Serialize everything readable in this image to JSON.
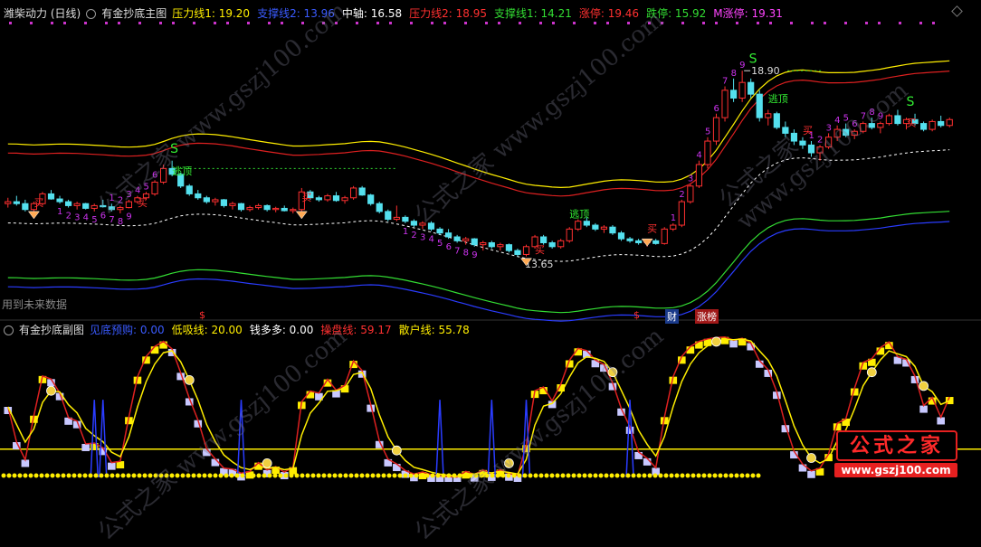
{
  "main_header": {
    "stock": "潍柴动力 (日线)",
    "indicator": "有金抄底主图",
    "items": [
      {
        "label": "压力线1: ",
        "value": "19.20",
        "color": "#ffee00"
      },
      {
        "label": "支撑线2: ",
        "value": "13.96",
        "color": "#3a5bff"
      },
      {
        "label": "中轴: ",
        "value": "16.58",
        "color": "#ffffff"
      },
      {
        "label": "压力线2: ",
        "value": "18.95",
        "color": "#ff3030"
      },
      {
        "label": "支撑线1: ",
        "value": "14.21",
        "color": "#33dd33"
      },
      {
        "label": "涨停: ",
        "value": "19.46",
        "color": "#ff3030"
      },
      {
        "label": "跌停: ",
        "value": "15.92",
        "color": "#33dd33"
      },
      {
        "label": "M涨停: ",
        "value": "19.31",
        "color": "#ff44ff"
      }
    ]
  },
  "sub_header": {
    "indicator": "有金抄底副图",
    "items": [
      {
        "label": "见底预购: ",
        "value": "0.00",
        "color": "#3a5bff"
      },
      {
        "label": "低吸线: ",
        "value": "20.00",
        "color": "#ffee00"
      },
      {
        "label": "钱多多: ",
        "value": "0.00",
        "color": "#ffffff"
      },
      {
        "label": "操盘线: ",
        "value": "59.17",
        "color": "#ff3030"
      },
      {
        "label": "散户线: ",
        "value": "55.78",
        "color": "#ffee00"
      }
    ]
  },
  "future_note": "用到未来数据",
  "bottom_badges": [
    {
      "text": "$",
      "color": "#ff3030"
    },
    {
      "text": "$",
      "color": "#ff3030"
    },
    {
      "text": "财",
      "color": "#ffffff"
    },
    {
      "text": "涨榜",
      "color": "#ffffff"
    }
  ],
  "watermark": "公式之家 www.gszj100.com",
  "logo": {
    "title": "公式之家",
    "url": "www.gszj100.com"
  },
  "colors": {
    "up": "#ff3030",
    "down": "#54e0ee",
    "upper1": "#ffee00",
    "upper2": "#dd2020",
    "mid": "#ffffff",
    "lower1": "#33dd33",
    "lower2": "#2a3cff"
  },
  "chart_data": {
    "type": "candlestick",
    "annotations": {
      "high": "18.90",
      "low": "13.65",
      "top_escape": "逃顶",
      "buy": "买",
      "signal": "S",
      "counts": [
        "1",
        "2",
        "3",
        "4",
        "5",
        "6",
        "7",
        "8",
        "9"
      ]
    },
    "price_ylim": [
      12.8,
      20.2
    ],
    "ohlc": [
      [
        15.5,
        15.65,
        15.4,
        15.55
      ],
      [
        15.55,
        15.7,
        15.45,
        15.5
      ],
      [
        15.5,
        15.6,
        15.3,
        15.35
      ],
      [
        15.35,
        15.55,
        15.3,
        15.5
      ],
      [
        15.5,
        15.8,
        15.45,
        15.75
      ],
      [
        15.75,
        15.85,
        15.6,
        15.62
      ],
      [
        15.62,
        15.7,
        15.5,
        15.55
      ],
      [
        15.55,
        15.6,
        15.4,
        15.45
      ],
      [
        15.45,
        15.55,
        15.35,
        15.5
      ],
      [
        15.5,
        15.52,
        15.35,
        15.38
      ],
      [
        15.38,
        15.5,
        15.3,
        15.45
      ],
      [
        15.45,
        15.6,
        15.4,
        15.42
      ],
      [
        15.42,
        15.5,
        15.3,
        15.35
      ],
      [
        15.35,
        15.45,
        15.25,
        15.4
      ],
      [
        15.4,
        15.6,
        15.38,
        15.55
      ],
      [
        15.55,
        15.7,
        15.5,
        15.65
      ],
      [
        15.65,
        15.8,
        15.6,
        15.75
      ],
      [
        15.75,
        16.1,
        15.7,
        16.05
      ],
      [
        16.05,
        16.5,
        16.0,
        16.4
      ],
      [
        16.4,
        16.6,
        16.2,
        16.25
      ],
      [
        16.25,
        16.3,
        15.9,
        15.95
      ],
      [
        15.95,
        16.0,
        15.7,
        15.75
      ],
      [
        15.75,
        15.85,
        15.6,
        15.65
      ],
      [
        15.65,
        15.7,
        15.5,
        15.55
      ],
      [
        15.55,
        15.65,
        15.45,
        15.6
      ],
      [
        15.6,
        15.62,
        15.4,
        15.45
      ],
      [
        15.45,
        15.55,
        15.35,
        15.5
      ],
      [
        15.5,
        15.52,
        15.3,
        15.35
      ],
      [
        15.35,
        15.45,
        15.3,
        15.4
      ],
      [
        15.4,
        15.5,
        15.35,
        15.45
      ],
      [
        15.45,
        15.48,
        15.3,
        15.35
      ],
      [
        15.35,
        15.42,
        15.28,
        15.38
      ],
      [
        15.38,
        15.45,
        15.3,
        15.32
      ],
      [
        15.32,
        15.4,
        15.25,
        15.35
      ],
      [
        15.35,
        15.9,
        15.3,
        15.8
      ],
      [
        15.8,
        15.85,
        15.6,
        15.65
      ],
      [
        15.65,
        15.7,
        15.55,
        15.6
      ],
      [
        15.6,
        15.75,
        15.55,
        15.7
      ],
      [
        15.7,
        15.8,
        15.55,
        15.58
      ],
      [
        15.58,
        15.7,
        15.5,
        15.65
      ],
      [
        15.65,
        15.95,
        15.6,
        15.9
      ],
      [
        15.9,
        15.95,
        15.7,
        15.72
      ],
      [
        15.72,
        15.75,
        15.45,
        15.5
      ],
      [
        15.5,
        15.55,
        15.25,
        15.3
      ],
      [
        15.3,
        15.35,
        15.05,
        15.1
      ],
      [
        15.1,
        15.45,
        15.05,
        15.15
      ],
      [
        15.15,
        15.2,
        15.0,
        15.05
      ],
      [
        15.05,
        15.1,
        14.9,
        14.95
      ],
      [
        14.95,
        15.05,
        14.85,
        15.0
      ],
      [
        15.0,
        15.05,
        14.8,
        14.85
      ],
      [
        14.85,
        14.9,
        14.7,
        14.75
      ],
      [
        14.75,
        14.85,
        14.6,
        14.65
      ],
      [
        14.65,
        14.7,
        14.5,
        14.55
      ],
      [
        14.55,
        14.65,
        14.45,
        14.6
      ],
      [
        14.6,
        14.62,
        14.4,
        14.45
      ],
      [
        14.45,
        14.55,
        14.3,
        14.5
      ],
      [
        14.5,
        14.55,
        14.35,
        14.4
      ],
      [
        14.4,
        14.5,
        14.3,
        14.45
      ],
      [
        14.45,
        14.48,
        14.25,
        14.3
      ],
      [
        14.3,
        14.35,
        14.15,
        14.2
      ],
      [
        14.2,
        14.45,
        14.15,
        14.4
      ],
      [
        14.4,
        14.7,
        14.35,
        14.65
      ],
      [
        14.65,
        14.7,
        14.45,
        14.5
      ],
      [
        14.5,
        14.55,
        14.35,
        14.4
      ],
      [
        14.4,
        14.6,
        14.35,
        14.55
      ],
      [
        14.55,
        14.9,
        14.5,
        14.85
      ],
      [
        14.85,
        15.1,
        14.8,
        15.05
      ],
      [
        15.05,
        15.15,
        14.9,
        14.95
      ],
      [
        14.95,
        15.0,
        14.8,
        14.85
      ],
      [
        14.85,
        14.95,
        14.75,
        14.9
      ],
      [
        14.9,
        14.95,
        14.7,
        14.75
      ],
      [
        14.75,
        14.8,
        14.55,
        14.6
      ],
      [
        14.6,
        14.65,
        14.5,
        14.55
      ],
      [
        14.55,
        14.6,
        14.45,
        14.5
      ],
      [
        14.5,
        14.58,
        14.4,
        14.55
      ],
      [
        14.55,
        14.6,
        14.45,
        14.48
      ],
      [
        14.48,
        14.9,
        14.45,
        14.85
      ],
      [
        14.85,
        15.0,
        14.8,
        14.95
      ],
      [
        14.95,
        15.6,
        14.9,
        15.55
      ],
      [
        15.55,
        16.0,
        15.5,
        15.95
      ],
      [
        15.95,
        16.6,
        15.9,
        16.5
      ],
      [
        16.5,
        17.2,
        16.4,
        17.1
      ],
      [
        17.1,
        17.8,
        17.0,
        17.7
      ],
      [
        17.7,
        18.5,
        17.6,
        18.4
      ],
      [
        18.4,
        18.7,
        18.1,
        18.2
      ],
      [
        18.2,
        18.9,
        18.1,
        18.6
      ],
      [
        18.6,
        18.7,
        18.2,
        18.3
      ],
      [
        18.3,
        18.4,
        17.6,
        17.7
      ],
      [
        17.7,
        17.9,
        17.5,
        17.8
      ],
      [
        17.8,
        17.85,
        17.4,
        17.45
      ],
      [
        17.45,
        17.6,
        17.2,
        17.3
      ],
      [
        17.3,
        17.4,
        17.0,
        17.1
      ],
      [
        17.1,
        17.2,
        16.9,
        17.0
      ],
      [
        17.0,
        17.1,
        16.7,
        16.8
      ],
      [
        16.8,
        17.0,
        16.6,
        16.95
      ],
      [
        16.95,
        17.3,
        16.9,
        17.2
      ],
      [
        17.2,
        17.5,
        17.1,
        17.4
      ],
      [
        17.4,
        17.55,
        17.2,
        17.25
      ],
      [
        17.25,
        17.4,
        17.15,
        17.35
      ],
      [
        17.35,
        17.6,
        17.3,
        17.55
      ],
      [
        17.55,
        17.7,
        17.4,
        17.45
      ],
      [
        17.45,
        17.6,
        17.3,
        17.55
      ],
      [
        17.55,
        17.8,
        17.5,
        17.75
      ],
      [
        17.75,
        17.9,
        17.5,
        17.55
      ],
      [
        17.55,
        17.7,
        17.4,
        17.65
      ],
      [
        17.65,
        17.8,
        17.5,
        17.55
      ],
      [
        17.55,
        17.6,
        17.35,
        17.4
      ],
      [
        17.4,
        17.65,
        17.35,
        17.6
      ],
      [
        17.6,
        17.75,
        17.45,
        17.5
      ],
      [
        17.5,
        17.7,
        17.45,
        17.65
      ]
    ]
  }
}
